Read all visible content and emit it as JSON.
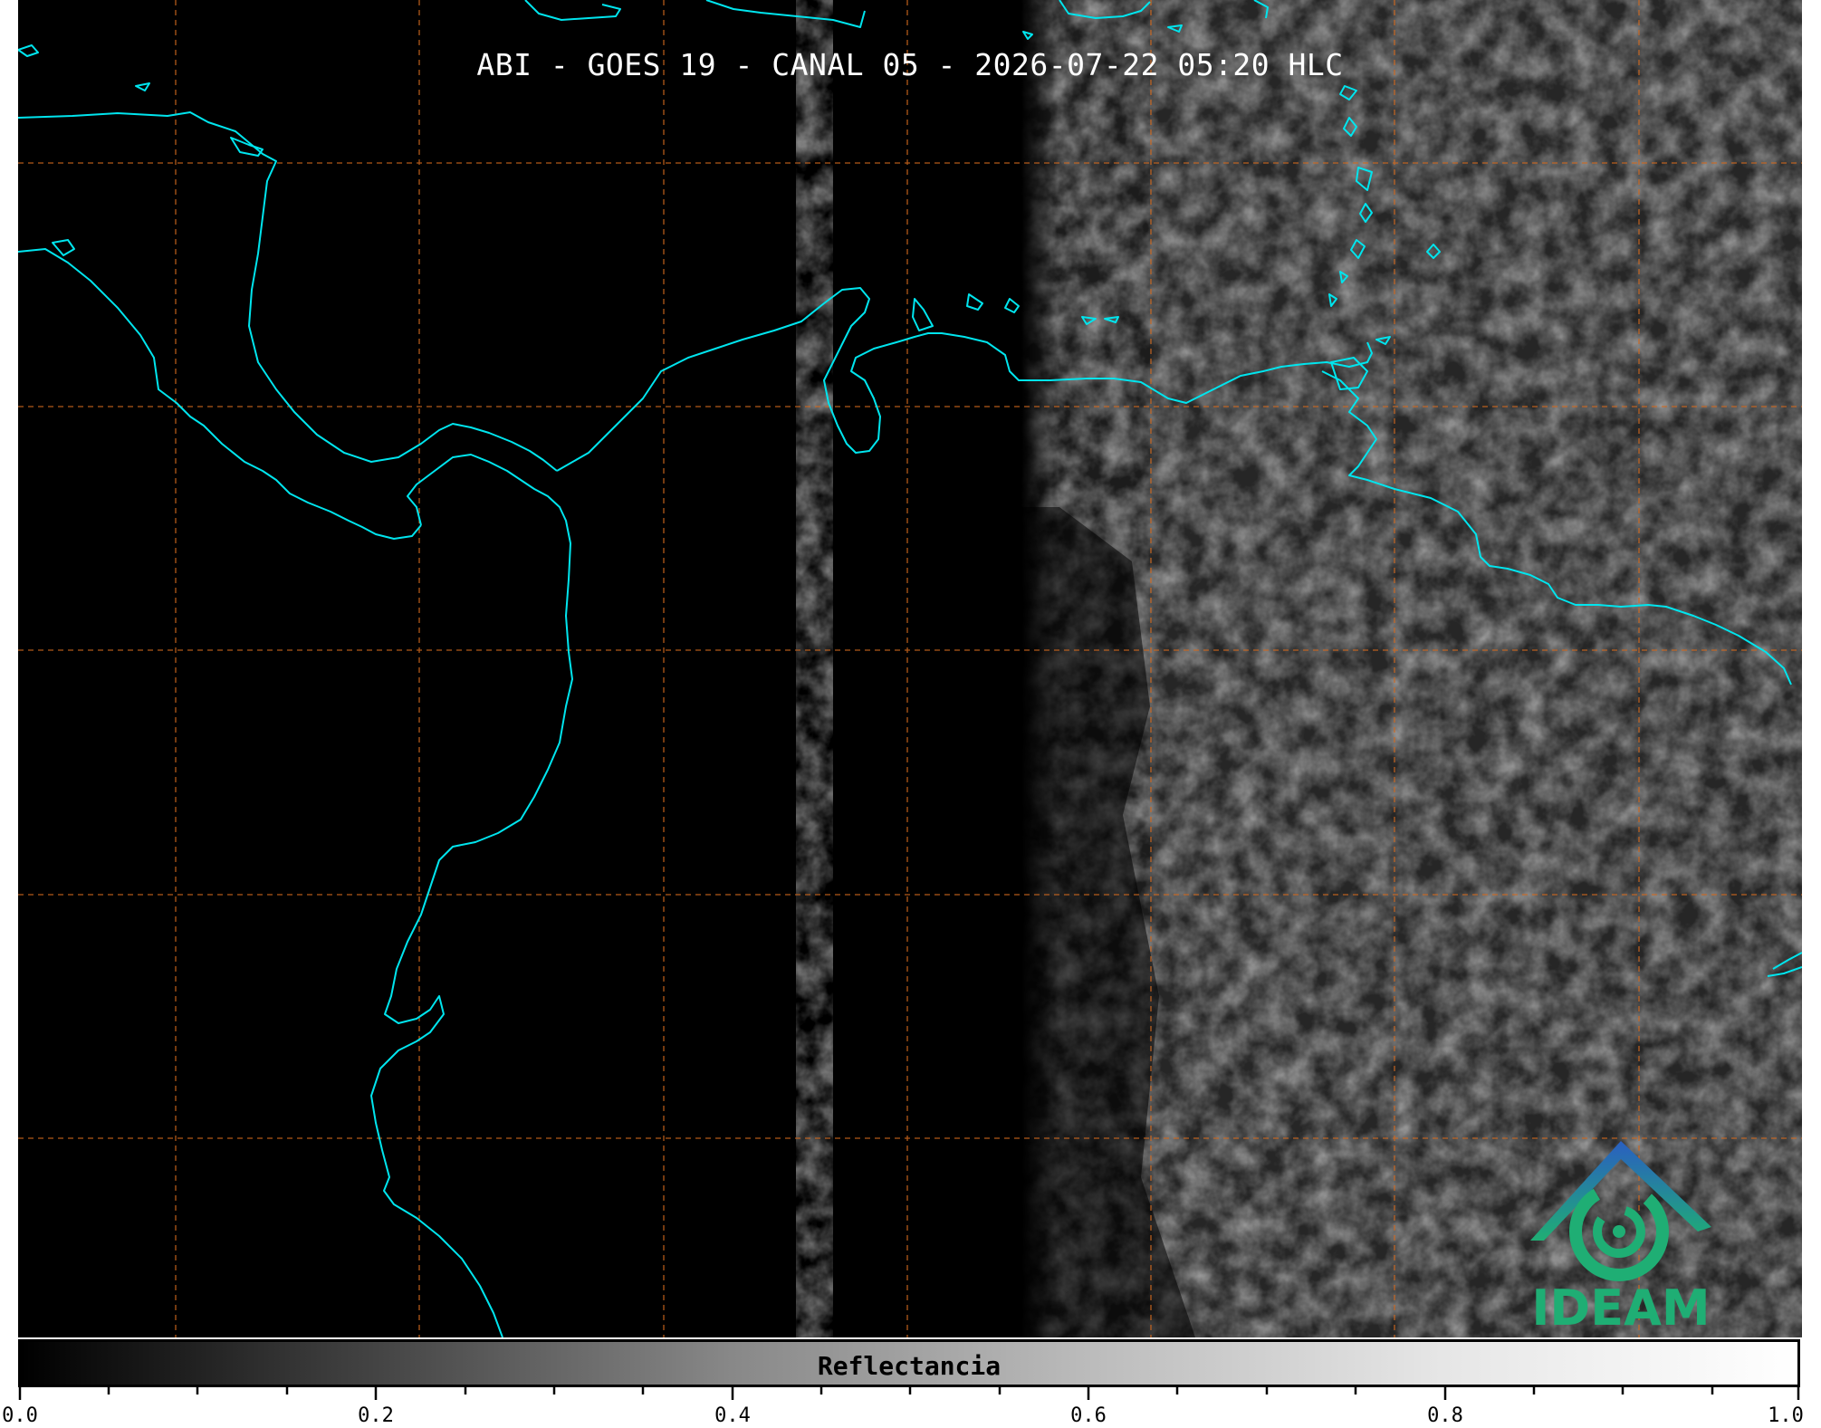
{
  "title": "ABI - GOES 19 - CANAL 05 - 2026-07-22 05:20 HLC",
  "colorbar": {
    "label": "Reflectancia",
    "ticks": [
      "0.0",
      "0.2",
      "0.4",
      "0.6",
      "0.8",
      "1.0"
    ],
    "range": [
      0.0,
      1.0
    ],
    "colormap": "grayscale"
  },
  "logo": {
    "text": "IDEAM",
    "icon": "ideam-logo-icon"
  },
  "colors": {
    "coastline": "#00e5ee",
    "gridlines": "#d2691e",
    "background": "#000000",
    "logo_green": "#1fae74",
    "logo_blue": "#2a7fc1"
  }
}
